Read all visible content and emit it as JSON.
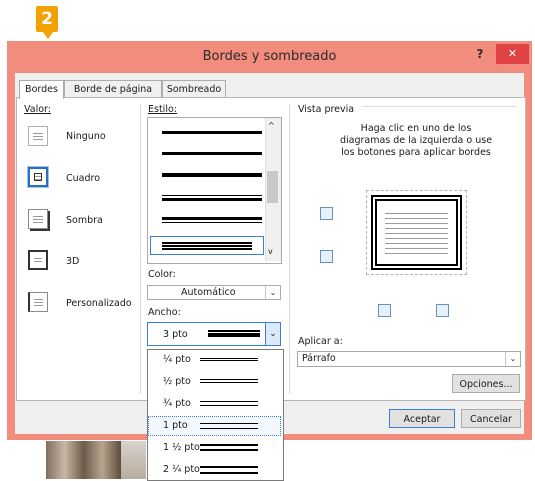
{
  "step_badge": "2",
  "dialog": {
    "title": "Bordes y sombreado",
    "help_label": "?",
    "close_label": "✕"
  },
  "tabs": [
    {
      "label": "Bordes",
      "active": true
    },
    {
      "label": "Borde de página",
      "active": false
    },
    {
      "label": "Sombreado",
      "active": false
    }
  ],
  "setting": {
    "label": "Valor:",
    "options": [
      {
        "label": "Ninguno",
        "icon": "setting-none-icon",
        "selected": false
      },
      {
        "label": "Cuadro",
        "icon": "setting-box-icon",
        "selected": true
      },
      {
        "label": "Sombra",
        "icon": "setting-shadow-icon",
        "selected": false
      },
      {
        "label": "3D",
        "icon": "setting-3d-icon",
        "selected": false
      },
      {
        "label": "Personalizado",
        "icon": "setting-custom-icon",
        "selected": false
      }
    ]
  },
  "style": {
    "label": "Estilo:",
    "scroll_up": "^",
    "scroll_down": "v"
  },
  "color": {
    "label": "Color:",
    "value": "Automático"
  },
  "width": {
    "label": "Ancho:",
    "value": "3 pto",
    "options": [
      "¼ pto",
      "½ pto",
      "¾ pto",
      "1 pto",
      "1 ½ pto",
      "2 ¼ pto"
    ],
    "selected_option": "1 pto"
  },
  "preview": {
    "label": "Vista previa",
    "instructions": "Haga clic en uno de los diagramas de la izquierda o use los botones para aplicar bordes"
  },
  "apply_to": {
    "label": "Aplicar a:",
    "value": "Párrafo"
  },
  "buttons": {
    "options": "Opciones...",
    "ok": "Aceptar",
    "cancel": "Cancelar"
  },
  "colors": {
    "dialog_frame": "#f28c7c",
    "close_button": "#e04343",
    "badge": "#f2a100",
    "selection": "#2a6fbe"
  }
}
